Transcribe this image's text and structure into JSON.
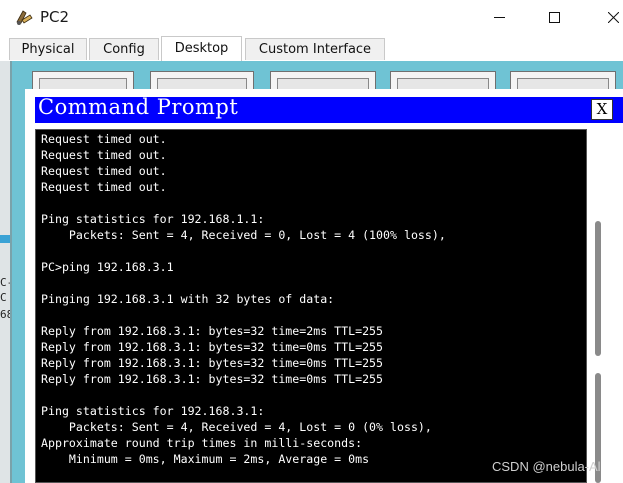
{
  "window": {
    "title": "PC2",
    "icon": "packet-tracer-pc-icon"
  },
  "tabs": [
    {
      "label": "Physical",
      "active": false
    },
    {
      "label": "Config",
      "active": false
    },
    {
      "label": "Desktop",
      "active": true
    },
    {
      "label": "Custom Interface",
      "active": false
    }
  ],
  "command_prompt": {
    "title": "Command Prompt",
    "close_label": "X",
    "lines": [
      "Request timed out.",
      "Request timed out.",
      "Request timed out.",
      "Request timed out.",
      "",
      "Ping statistics for 192.168.1.1:",
      "    Packets: Sent = 4, Received = 0, Lost = 4 (100% loss),",
      "",
      "PC>ping 192.168.3.1",
      "",
      "Pinging 192.168.3.1 with 32 bytes of data:",
      "",
      "Reply from 192.168.3.1: bytes=32 time=2ms TTL=255",
      "Reply from 192.168.3.1: bytes=32 time=0ms TTL=255",
      "Reply from 192.168.3.1: bytes=32 time=0ms TTL=255",
      "Reply from 192.168.3.1: bytes=32 time=0ms TTL=255",
      "",
      "Ping statistics for 192.168.3.1:",
      "    Packets: Sent = 4, Received = 4, Lost = 0 (0% loss),",
      "Approximate round trip times in milli-seconds:",
      "    Minimum = 0ms, Maximum = 2ms, Average = 0ms"
    ]
  },
  "background_fragments": [
    "C-",
    "C",
    "68"
  ],
  "watermark": "CSDN @nebula-Al",
  "colors": {
    "desktop_bg": "#6fc3d4",
    "cmd_title_bar": "#0000ff",
    "terminal_bg": "#000000",
    "terminal_text": "#ffffff"
  }
}
